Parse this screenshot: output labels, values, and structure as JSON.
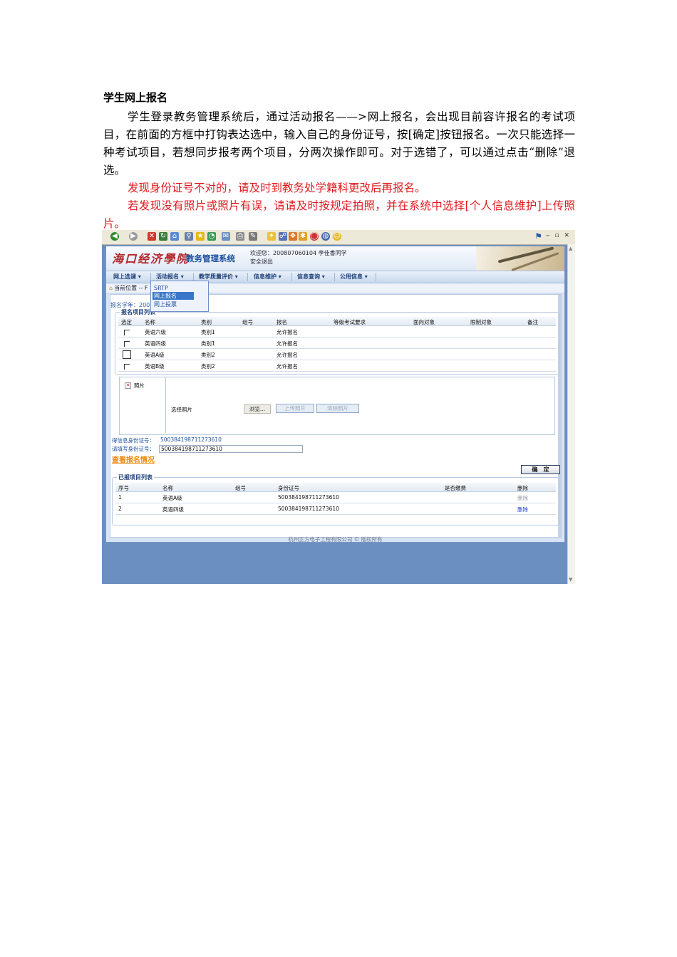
{
  "document": {
    "title": "学生网上报名",
    "para1": "学生登录教务管理系统后，通过活动报名——>网上报名，会出现目前容许报名的考试项目，在前面的方框中打钩表达选中，输入自己的身份证号，按[确定]按钮报名。一次只能选择一种考试项目，若想同步报考两个项目，分两次操作即可。对于选错了，可以通过点击“删除”退选。",
    "para2": "发现身份证号不对的，请及时到教务处学籍科更改后再报名。",
    "para3": "若发现没有照片或照片有误，请请及时按规定拍照，并在系统中选择[个人信息维护]上传照片。"
  },
  "browser": {
    "toolbar_icons": [
      "back-icon",
      "forward-icon",
      "stop-icon",
      "refresh-icon",
      "home-icon",
      "search-icon",
      "favorites-icon",
      "history-icon",
      "mail-icon",
      "print-icon",
      "edit-icon",
      "discuss-icon",
      "messenger-icon"
    ]
  },
  "app": {
    "logo_calligraphy": "海口经济學院",
    "logo_system": "教务管理系统",
    "welcome": "欢迎您：200807060104 李佳香同学",
    "logout": "安全退出",
    "menu": [
      {
        "label": "网上选课"
      },
      {
        "label": "活动报名"
      },
      {
        "label": "教学质量评价"
      },
      {
        "label": "信息维护"
      },
      {
        "label": "信息查询"
      },
      {
        "label": "公用信息"
      }
    ],
    "breadcrumb": "当前位置 -- F",
    "dropdown": [
      "SRTP",
      "网上报名",
      "网上投票"
    ],
    "term_label": "报名学年：200",
    "signup_table": {
      "legend": "报名项目列表",
      "headers": [
        "选定",
        "名称",
        "类别",
        "组号",
        "报名",
        "等级考试要求",
        "面向对象",
        "限制对象",
        "备注"
      ],
      "rows": [
        {
          "name": "英语六级",
          "category": "类别1",
          "group": "",
          "signup": "允许报名"
        },
        {
          "name": "英语四级",
          "category": "类别1",
          "group": "",
          "signup": "允许报名"
        },
        {
          "name": "英语A级",
          "category": "类别2",
          "group": "",
          "signup": "允许报名"
        },
        {
          "name": "英语B级",
          "category": "类别2",
          "group": "",
          "signup": "允许报名"
        }
      ]
    },
    "photo": {
      "label": "照片",
      "choose_label": "选择照片",
      "browse": "浏览...",
      "upload": "上传照片",
      "clear": "清除照片"
    },
    "id_info_label": "得信息身份证号：",
    "id_info_value": "500384198711273610",
    "id_input_label": "请填写身份证号：",
    "id_input_value": "500384198711273610",
    "view_link": "查看报名情况",
    "confirm": "确　定",
    "signed_table": {
      "legend": "已报项目列表",
      "headers": [
        "序号",
        "名称",
        "组号",
        "身份证号",
        "是否缴费",
        "删除"
      ],
      "rows": [
        {
          "no": "1",
          "name": "英语A级",
          "group": "",
          "id": "500384198711273610",
          "paid": "",
          "del": "删除"
        },
        {
          "no": "2",
          "name": "英语四级",
          "group": "",
          "id": "500384198711273610",
          "paid": "",
          "del": "删除"
        }
      ]
    },
    "footer": "杭州正方电子工程有限公司 © 版权所有"
  }
}
